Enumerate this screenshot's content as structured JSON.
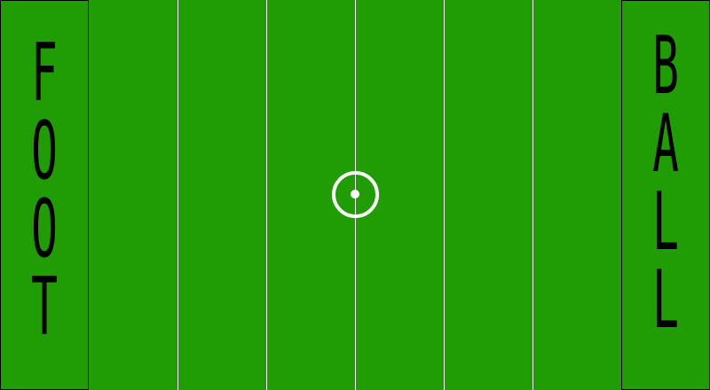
{
  "field": {
    "color": "#209c04",
    "line_color": "#ffffff",
    "endzone_border_color": "#000000"
  },
  "endzones": {
    "left": {
      "word": "FOOT",
      "letters": [
        "F",
        "O",
        "O",
        "T"
      ]
    },
    "right": {
      "word": "BALL",
      "letters": [
        "B",
        "A",
        "L",
        "L"
      ]
    }
  },
  "center_mark": {
    "shape": "ring-with-dot"
  }
}
